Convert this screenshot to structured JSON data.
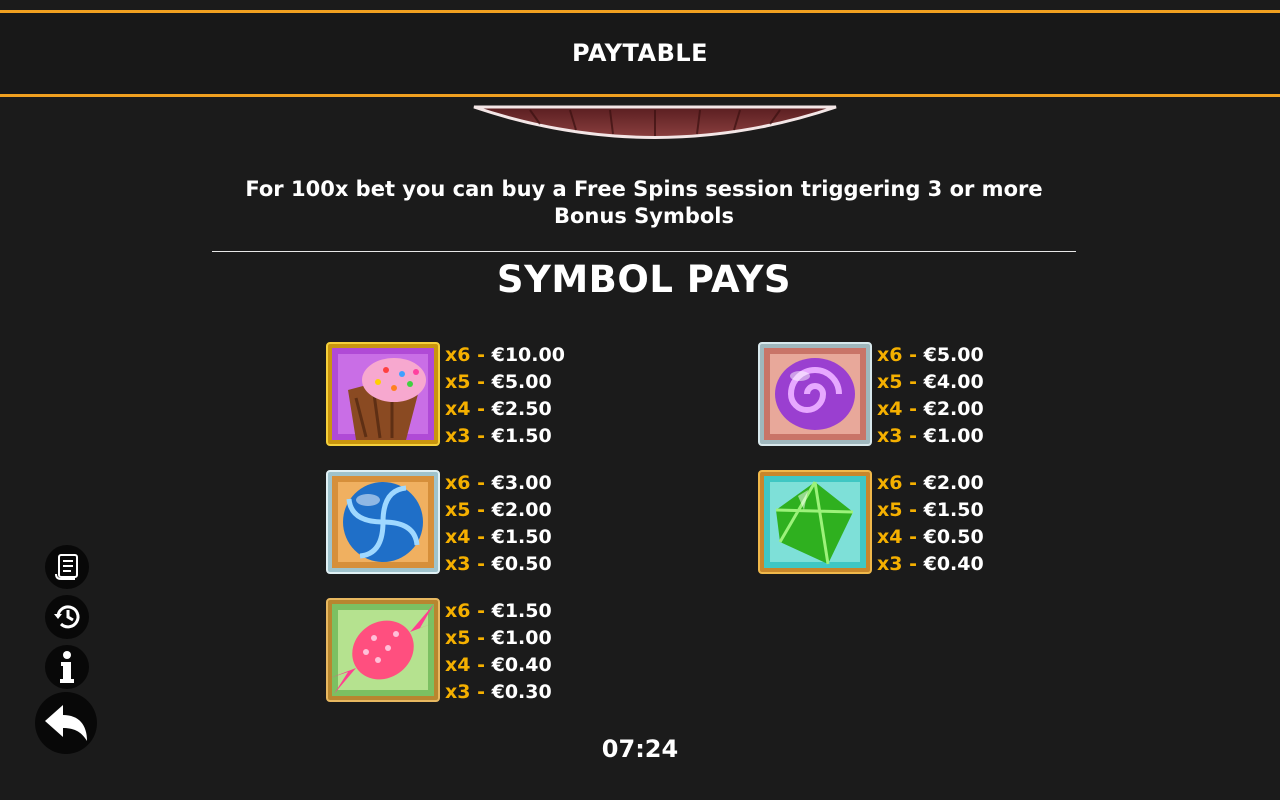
{
  "header": {
    "title": "PAYTABLE"
  },
  "bonus_note": "For 100x bet you can buy a Free Spins session triggering 3 or more Bonus Symbols",
  "section_title": "SYMBOL PAYS",
  "symbols": [
    {
      "icon": "cupcake-icon",
      "pays": [
        {
          "count": "x6 - ",
          "amount": "€10.00"
        },
        {
          "count": "x5 - ",
          "amount": "€5.00"
        },
        {
          "count": "x4 - ",
          "amount": "€2.50"
        },
        {
          "count": "x3 - ",
          "amount": "€1.50"
        }
      ]
    },
    {
      "icon": "purple-swirl-candy-icon",
      "pays": [
        {
          "count": "x6 - ",
          "amount": "€5.00"
        },
        {
          "count": "x5 - ",
          "amount": "€4.00"
        },
        {
          "count": "x4 - ",
          "amount": "€2.00"
        },
        {
          "count": "x3 - ",
          "amount": "€1.00"
        }
      ]
    },
    {
      "icon": "blue-lollipop-candy-icon",
      "pays": [
        {
          "count": "x6 - ",
          "amount": "€3.00"
        },
        {
          "count": "x5 - ",
          "amount": "€2.00"
        },
        {
          "count": "x4 - ",
          "amount": "€1.50"
        },
        {
          "count": "x3 - ",
          "amount": "€0.50"
        }
      ]
    },
    {
      "icon": "green-gem-candy-icon",
      "pays": [
        {
          "count": "x6 - ",
          "amount": "€2.00"
        },
        {
          "count": "x5 - ",
          "amount": "€1.50"
        },
        {
          "count": "x4 - ",
          "amount": "€0.50"
        },
        {
          "count": "x3 - ",
          "amount": "€0.40"
        }
      ]
    },
    {
      "icon": "pink-wrapped-candy-icon",
      "pays": [
        {
          "count": "x6 - ",
          "amount": "€1.50"
        },
        {
          "count": "x5 - ",
          "amount": "€1.00"
        },
        {
          "count": "x4 - ",
          "amount": "€0.40"
        },
        {
          "count": "x3 - ",
          "amount": "€0.30"
        }
      ]
    }
  ],
  "side_buttons": [
    "rules-scroll-icon",
    "history-icon",
    "info-icon",
    "back-arrow-icon"
  ],
  "clock": "07:24",
  "colors": {
    "accent": "#f0a020",
    "multiplier": "#f5b000",
    "background": "#1b1b1b"
  }
}
